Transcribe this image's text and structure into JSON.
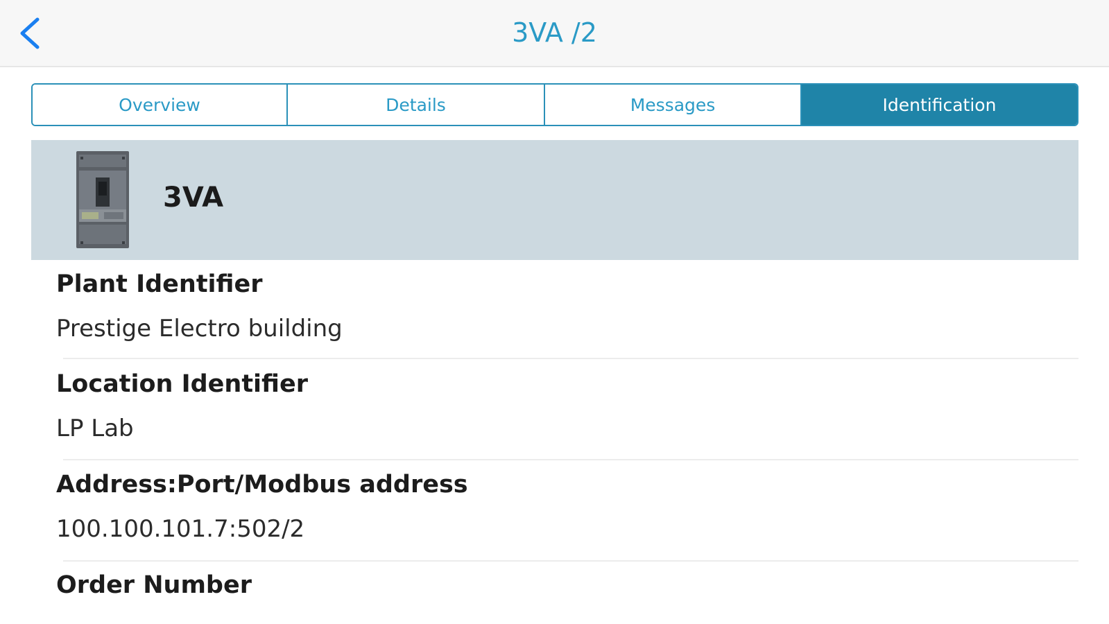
{
  "header": {
    "title": "3VA /2",
    "back_icon": "chevron-left-icon"
  },
  "tabs": [
    {
      "label": "Overview",
      "active": false
    },
    {
      "label": "Details",
      "active": false
    },
    {
      "label": "Messages",
      "active": false
    },
    {
      "label": "Identification",
      "active": true
    }
  ],
  "device": {
    "name": "3VA",
    "image_icon": "circuit-breaker-image"
  },
  "fields": [
    {
      "label": "Plant Identifier",
      "value": "Prestige Electro building"
    },
    {
      "label": "Location Identifier",
      "value": "LP Lab"
    },
    {
      "label": "Address:Port/Modbus address",
      "value": "100.100.101.7:502/2"
    },
    {
      "label": "Order Number",
      "value": ""
    }
  ],
  "colors": {
    "accent": "#2a9ac6",
    "active_tab": "#1f84a8",
    "device_header_bg": "#ccd9e0"
  }
}
